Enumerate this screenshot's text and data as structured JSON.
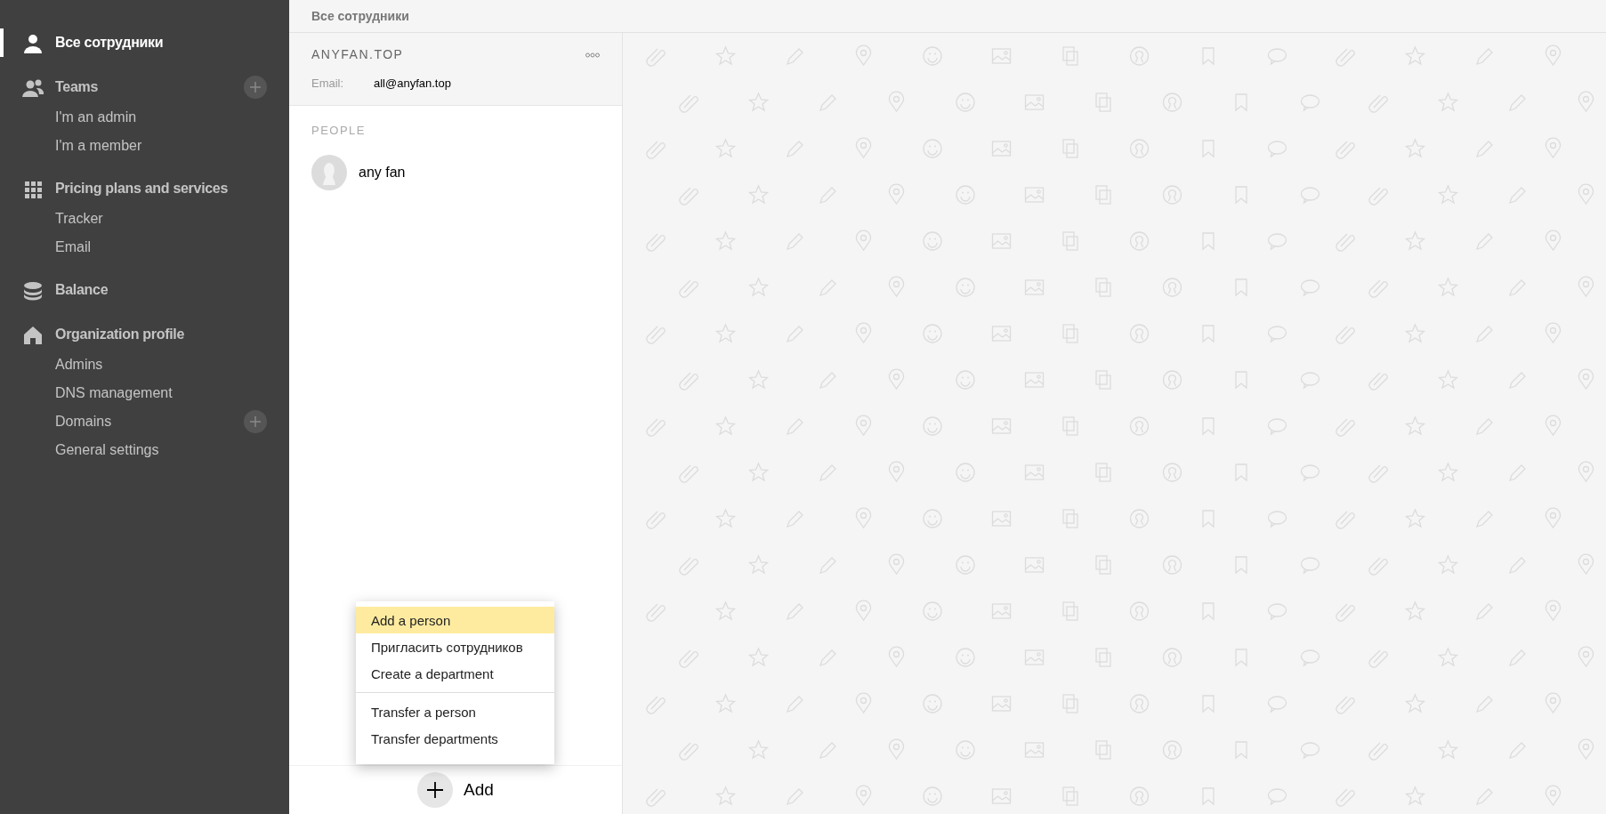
{
  "sidebar": {
    "sections": [
      {
        "label": "Все сотрудники",
        "selected": true,
        "has_add": false
      },
      {
        "label": "Teams",
        "selected": false,
        "has_add": true,
        "items": [
          {
            "label": "I'm an admin",
            "has_add": false
          },
          {
            "label": "I'm a member",
            "has_add": false
          }
        ]
      },
      {
        "label": "Pricing plans and services",
        "selected": false,
        "has_add": false,
        "items": [
          {
            "label": "Tracker",
            "has_add": false
          },
          {
            "label": "Email",
            "has_add": false
          }
        ]
      },
      {
        "label": "Balance",
        "selected": false,
        "has_add": false
      },
      {
        "label": "Organization profile",
        "selected": false,
        "has_add": false,
        "items": [
          {
            "label": "Admins",
            "has_add": false
          },
          {
            "label": "DNS management",
            "has_add": false
          },
          {
            "label": "Domains",
            "has_add": true
          },
          {
            "label": "General settings",
            "has_add": false
          }
        ]
      }
    ]
  },
  "header": {
    "title": "Все сотрудники"
  },
  "organization": {
    "name": "ANYFAN.TOP",
    "fields": [
      {
        "label": "Email:",
        "value": "all@anyfan.top"
      }
    ]
  },
  "people": {
    "heading": "PEOPLE",
    "items": [
      {
        "name": "any fan"
      }
    ]
  },
  "add_menu": {
    "groups": [
      [
        {
          "label": "Add a person",
          "selected": true
        },
        {
          "label": "Пригласить сотрудников",
          "selected": false
        },
        {
          "label": "Create a department",
          "selected": false
        }
      ],
      [
        {
          "label": "Transfer a person",
          "selected": false
        },
        {
          "label": "Transfer departments",
          "selected": false
        }
      ]
    ]
  },
  "add_button": {
    "label": "Add"
  }
}
